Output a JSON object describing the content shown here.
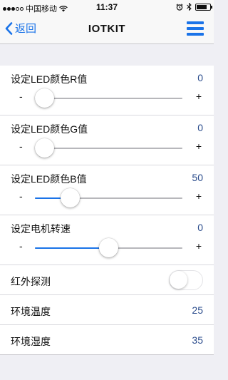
{
  "status_bar": {
    "carrier": "中国移动",
    "time": "11:37",
    "signal_bars": 3,
    "battery_level": 0.8,
    "icons": [
      "wifi-icon",
      "alarm-icon",
      "bluetooth-icon",
      "battery-icon"
    ]
  },
  "nav": {
    "back_label": "返回",
    "title": "IOTKIT",
    "accent_color": "#1a73e8"
  },
  "sliders": [
    {
      "label": "设定LED颜色R值",
      "value": "0",
      "min_label": "-",
      "max_label": "+",
      "position": 0.0
    },
    {
      "label": "设定LED颜色G值",
      "value": "0",
      "min_label": "-",
      "max_label": "+",
      "position": 0.0
    },
    {
      "label": "设定LED颜色B值",
      "value": "50",
      "min_label": "-",
      "max_label": "+",
      "position": 0.2
    },
    {
      "label": "设定电机转速",
      "value": "0",
      "min_label": "-",
      "max_label": "+",
      "position": 0.5
    }
  ],
  "infrared": {
    "label": "红外探测",
    "on": false
  },
  "readings": [
    {
      "label": "环境温度",
      "value": "25"
    },
    {
      "label": "环境湿度",
      "value": "35"
    }
  ]
}
